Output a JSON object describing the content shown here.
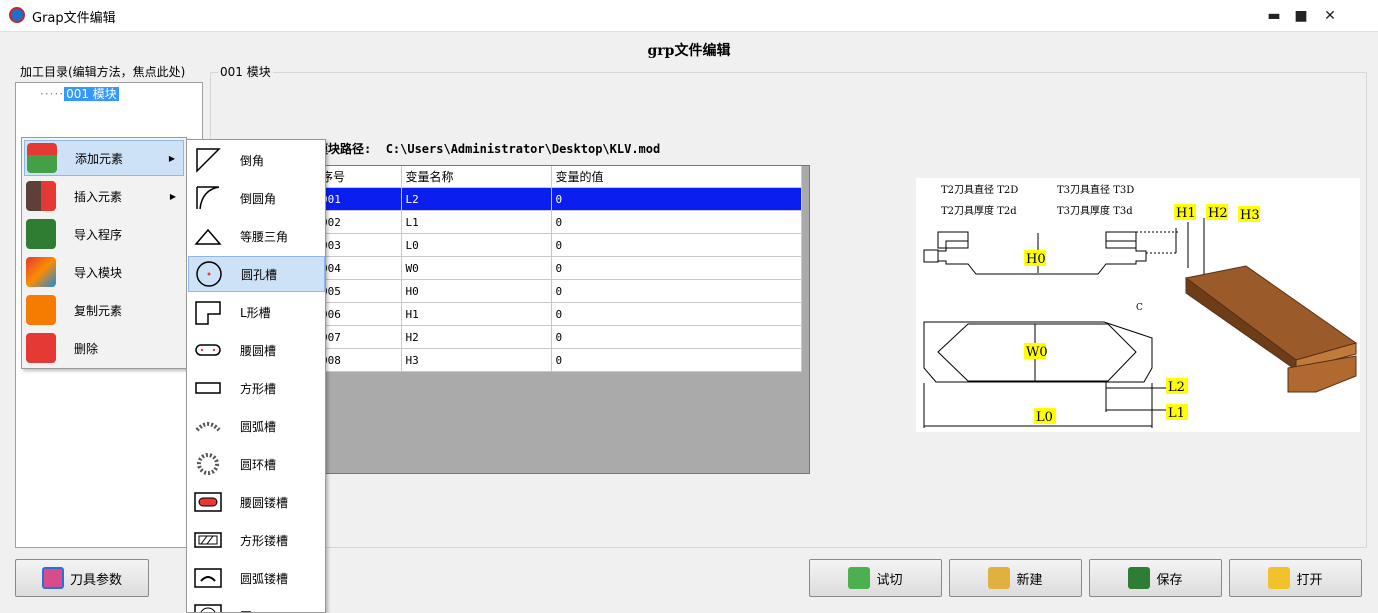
{
  "window": {
    "title": "Grap文件编辑",
    "minimize": "▬",
    "maximize": "■",
    "close": "✕"
  },
  "header": {
    "title": "grp文件编辑"
  },
  "tree": {
    "group_label": "加工目录(编辑方法，焦点此处)",
    "nodes": [
      {
        "dots": "·····",
        "label": "001 模块"
      }
    ]
  },
  "module": {
    "group_label": "001 模块",
    "path_label": "模块路径:",
    "path_value": "C:\\Users\\Administrator\\Desktop\\KLV.mod"
  },
  "grid": {
    "headers": [
      "序号",
      "变量名称",
      "变量的值"
    ],
    "rows": [
      [
        "001",
        "L2",
        "0"
      ],
      [
        "002",
        "L1",
        "0"
      ],
      [
        "003",
        "L0",
        "0"
      ],
      [
        "004",
        "W0",
        "0"
      ],
      [
        "005",
        "H0",
        "0"
      ],
      [
        "006",
        "H1",
        "0"
      ],
      [
        "007",
        "H2",
        "0"
      ],
      [
        "008",
        "H3",
        "0"
      ]
    ],
    "selected_row": 0
  },
  "diagram": {
    "texts": {
      "t2d": "T2刀具直径 T2D",
      "t3d": "T3刀具直径 T3D",
      "t2t": "T2刀具厚度 T2d",
      "t3t": "T3刀具厚度 T3d"
    },
    "labels": {
      "h1": "H1",
      "h2": "H2",
      "h3": "H3",
      "h0": "H0",
      "w0": "W0",
      "l0": "L0",
      "l1": "L1",
      "l2": "L2",
      "c": "C"
    }
  },
  "context_menu": {
    "items": [
      {
        "label": "添加元素",
        "icon": "add-element-icon",
        "submenu": true
      },
      {
        "label": "插入元素",
        "icon": "insert-element-icon",
        "submenu": true
      },
      {
        "label": "导入程序",
        "icon": "import-program-icon"
      },
      {
        "label": "导入模块",
        "icon": "import-module-icon"
      },
      {
        "label": "复制元素",
        "icon": "copy-element-icon"
      },
      {
        "label": "删除",
        "icon": "trash-icon"
      }
    ],
    "arrow": "▶"
  },
  "submenu": {
    "items": [
      {
        "label": "倒角",
        "icon": "chamfer-icon"
      },
      {
        "label": "倒圆角",
        "icon": "fillet-icon"
      },
      {
        "label": "等腰三角",
        "icon": "triangle-icon"
      },
      {
        "label": "圆孔槽",
        "icon": "round-hole-icon"
      },
      {
        "label": "L形槽",
        "icon": "l-slot-icon"
      },
      {
        "label": "腰圆槽",
        "icon": "oblong-slot-icon"
      },
      {
        "label": "方形槽",
        "icon": "rect-slot-icon"
      },
      {
        "label": "圆弧槽",
        "icon": "arc-slot-icon"
      },
      {
        "label": "圆环槽",
        "icon": "ring-slot-icon"
      },
      {
        "label": "腰圆镂槽",
        "icon": "oblong-through-icon"
      },
      {
        "label": "方形镂槽",
        "icon": "rect-through-icon"
      },
      {
        "label": "圆弧镂槽",
        "icon": "arc-through-icon"
      },
      {
        "label": "圆",
        "icon": "circle-through-icon"
      }
    ]
  },
  "buttons": {
    "tool_params": "刀具参数",
    "trial_cut": "试切",
    "new": "新建",
    "save": "保存",
    "open": "打开"
  },
  "colors": {
    "selected_row": "#0a1ef0",
    "menu_highlight": "#cde2f7",
    "label_bg": "#ffff00"
  }
}
